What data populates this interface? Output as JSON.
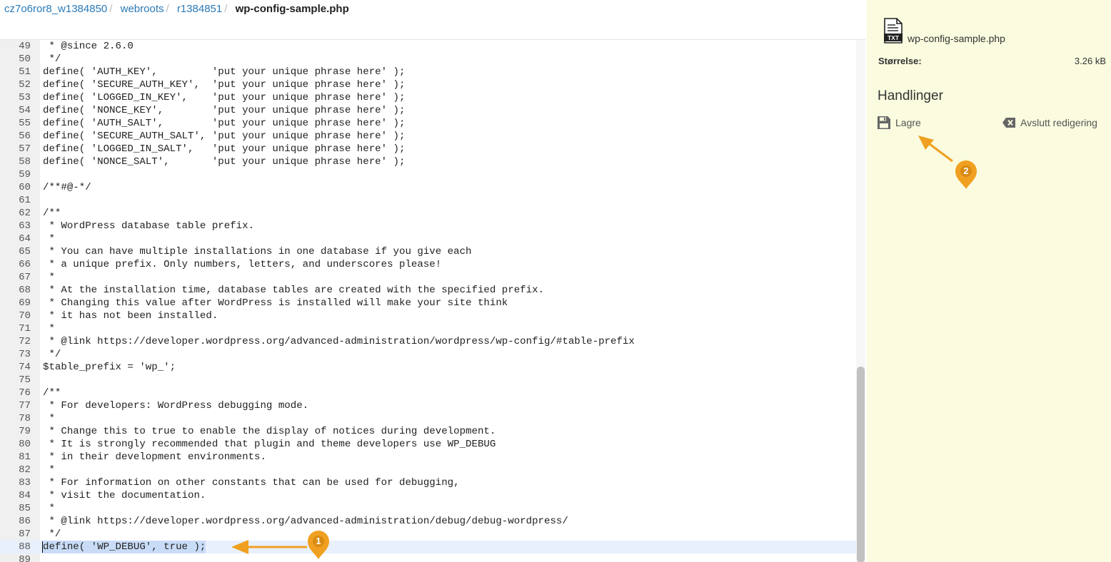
{
  "breadcrumb": {
    "items": [
      "cz7o6ror8_w1384850",
      "webroots",
      "r1384851"
    ],
    "separator": "/",
    "current": "wp-config-sample.php"
  },
  "editor": {
    "active_line": 88,
    "lines": [
      {
        "n": "49",
        "code": " * @since 2.6.0"
      },
      {
        "n": "50",
        "code": " */"
      },
      {
        "n": "51",
        "code": "define( 'AUTH_KEY',         'put your unique phrase here' );"
      },
      {
        "n": "52",
        "code": "define( 'SECURE_AUTH_KEY',  'put your unique phrase here' );"
      },
      {
        "n": "53",
        "code": "define( 'LOGGED_IN_KEY',    'put your unique phrase here' );"
      },
      {
        "n": "54",
        "code": "define( 'NONCE_KEY',        'put your unique phrase here' );"
      },
      {
        "n": "55",
        "code": "define( 'AUTH_SALT',        'put your unique phrase here' );"
      },
      {
        "n": "56",
        "code": "define( 'SECURE_AUTH_SALT', 'put your unique phrase here' );"
      },
      {
        "n": "57",
        "code": "define( 'LOGGED_IN_SALT',   'put your unique phrase here' );"
      },
      {
        "n": "58",
        "code": "define( 'NONCE_SALT',       'put your unique phrase here' );"
      },
      {
        "n": "59",
        "code": ""
      },
      {
        "n": "60",
        "code": "/**#@-*/"
      },
      {
        "n": "61",
        "code": ""
      },
      {
        "n": "62",
        "code": "/**"
      },
      {
        "n": "63",
        "code": " * WordPress database table prefix."
      },
      {
        "n": "64",
        "code": " *"
      },
      {
        "n": "65",
        "code": " * You can have multiple installations in one database if you give each"
      },
      {
        "n": "66",
        "code": " * a unique prefix. Only numbers, letters, and underscores please!"
      },
      {
        "n": "67",
        "code": " *"
      },
      {
        "n": "68",
        "code": " * At the installation time, database tables are created with the specified prefix."
      },
      {
        "n": "69",
        "code": " * Changing this value after WordPress is installed will make your site think"
      },
      {
        "n": "70",
        "code": " * it has not been installed."
      },
      {
        "n": "71",
        "code": " *"
      },
      {
        "n": "72",
        "code": " * @link https://developer.wordpress.org/advanced-administration/wordpress/wp-config/#table-prefix"
      },
      {
        "n": "73",
        "code": " */"
      },
      {
        "n": "74",
        "code": "$table_prefix = 'wp_';"
      },
      {
        "n": "75",
        "code": ""
      },
      {
        "n": "76",
        "code": "/**"
      },
      {
        "n": "77",
        "code": " * For developers: WordPress debugging mode."
      },
      {
        "n": "78",
        "code": " *"
      },
      {
        "n": "79",
        "code": " * Change this to true to enable the display of notices during development."
      },
      {
        "n": "80",
        "code": " * It is strongly recommended that plugin and theme developers use WP_DEBUG"
      },
      {
        "n": "81",
        "code": " * in their development environments."
      },
      {
        "n": "82",
        "code": " *"
      },
      {
        "n": "83",
        "code": " * For information on other constants that can be used for debugging,"
      },
      {
        "n": "84",
        "code": " * visit the documentation."
      },
      {
        "n": "85",
        "code": " *"
      },
      {
        "n": "86",
        "code": " * @link https://developer.wordpress.org/advanced-administration/debug/debug-wordpress/"
      },
      {
        "n": "87",
        "code": " */"
      },
      {
        "n": "88",
        "code": "define( 'WP_DEBUG', true );"
      },
      {
        "n": "89",
        "code": ""
      }
    ]
  },
  "panel": {
    "file_icon": "txt-file-icon",
    "file_icon_text": "TXT",
    "file_name": "wp-config-sample.php",
    "size_label": "Størrelse:",
    "size_value": "3.26 kB",
    "actions_title": "Handlinger",
    "save_label": "Lagre",
    "save_icon": "floppy-disk-icon",
    "exit_label": "Avslutt redigering",
    "exit_icon": "backspace-icon"
  },
  "callouts": {
    "marker1": "1",
    "marker2": "2",
    "color": "#f0a020"
  }
}
